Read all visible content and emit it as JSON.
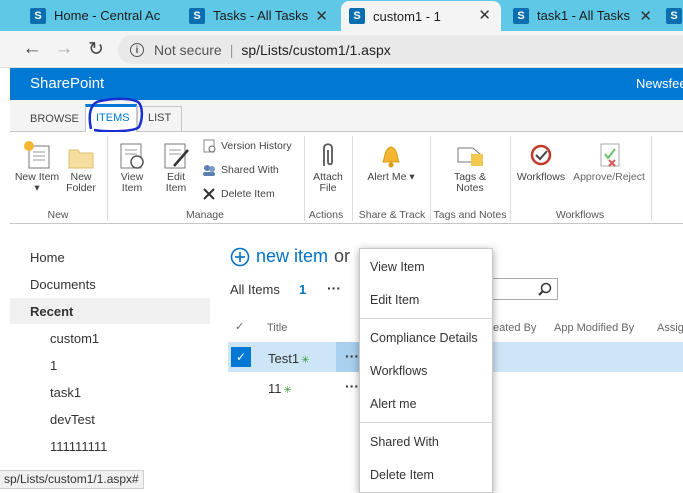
{
  "browser": {
    "tabs": [
      {
        "label": "Home - Central Ac",
        "active": false
      },
      {
        "label": "Tasks - All Tasks",
        "active": false
      },
      {
        "label": "custom1 - 1",
        "active": true
      },
      {
        "label": "task1 - All Tasks",
        "active": false
      }
    ],
    "security_label": "Not secure",
    "url": "sp/Lists/custom1/1.aspx"
  },
  "suite": {
    "brand": "SharePoint",
    "newsfeed": "Newsfee"
  },
  "ribbon_tabs": {
    "browse": "BROWSE",
    "items": "ITEMS",
    "list": "LIST"
  },
  "ribbon": {
    "new_item": "New Item",
    "new_folder": "New Folder",
    "view_item": "View Item",
    "edit_item": "Edit Item",
    "version_history": "Version History",
    "shared_with": "Shared With",
    "delete_item": "Delete Item",
    "attach_file": "Attach File",
    "alert_me": "Alert Me",
    "tags_notes": "Tags & Notes",
    "workflows": "Workflows",
    "approve_reject": "Approve/Reject",
    "groups": {
      "new": "New",
      "manage": "Manage",
      "actions": "Actions",
      "share_track": "Share & Track",
      "tags_notes": "Tags and Notes",
      "workflows": "Workflows"
    }
  },
  "left_nav": {
    "home": "Home",
    "documents": "Documents",
    "recent": "Recent",
    "recent_items": [
      "custom1",
      "1",
      "task1",
      "devTest",
      "111111111"
    ]
  },
  "list": {
    "new_item": "new item",
    "or": "or",
    "view_name": "All Items",
    "view_count": "1",
    "more": "···",
    "columns": {
      "title": "Title",
      "created_by": "eated By",
      "app_modified_by": "App Modified By",
      "assigned": "Assig"
    },
    "rows": [
      {
        "title": "Test1",
        "selected": true
      },
      {
        "title": "11",
        "selected": false
      }
    ]
  },
  "context_menu": {
    "items": [
      "View Item",
      "Edit Item",
      "Compliance Details",
      "Workflows",
      "Alert me",
      "Shared With",
      "Delete Item"
    ]
  },
  "status_bar": {
    "text": "sp/Lists/custom1/1.aspx#"
  },
  "colors": {
    "accent": "#0078d4",
    "tabstrip": "#5ec8e6",
    "selected_row": "#cde6f7"
  }
}
